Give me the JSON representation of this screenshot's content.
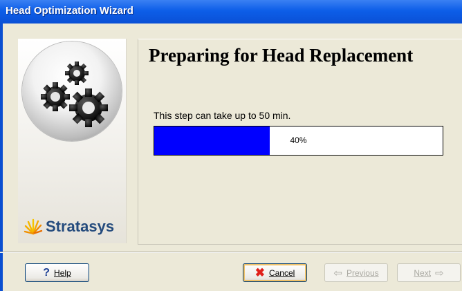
{
  "window": {
    "title": "Head Optimization Wizard"
  },
  "sidebar": {
    "brand": "Stratasys",
    "logo_icon": "gears-icon",
    "brand_icon": "stratasys-logo-icon"
  },
  "page": {
    "heading": "Preparing for Head Replacement",
    "step_text": "This step can take up to 50 min."
  },
  "progress": {
    "value": 40,
    "label": "40%",
    "fill_color": "#0000ff"
  },
  "buttons": {
    "help": {
      "label": "Help",
      "icon": "question-mark-icon"
    },
    "cancel": {
      "label": "Cancel",
      "icon": "red-x-icon"
    },
    "previous": {
      "label": "Previous",
      "icon": "back-arrow-icon",
      "disabled": true
    },
    "next": {
      "label": "Next",
      "icon": "forward-arrow-icon",
      "disabled": true
    }
  },
  "colors": {
    "title_bar": "#0d5ee8",
    "brand_text": "#244b7d",
    "cancel_x": "#e0201b"
  }
}
